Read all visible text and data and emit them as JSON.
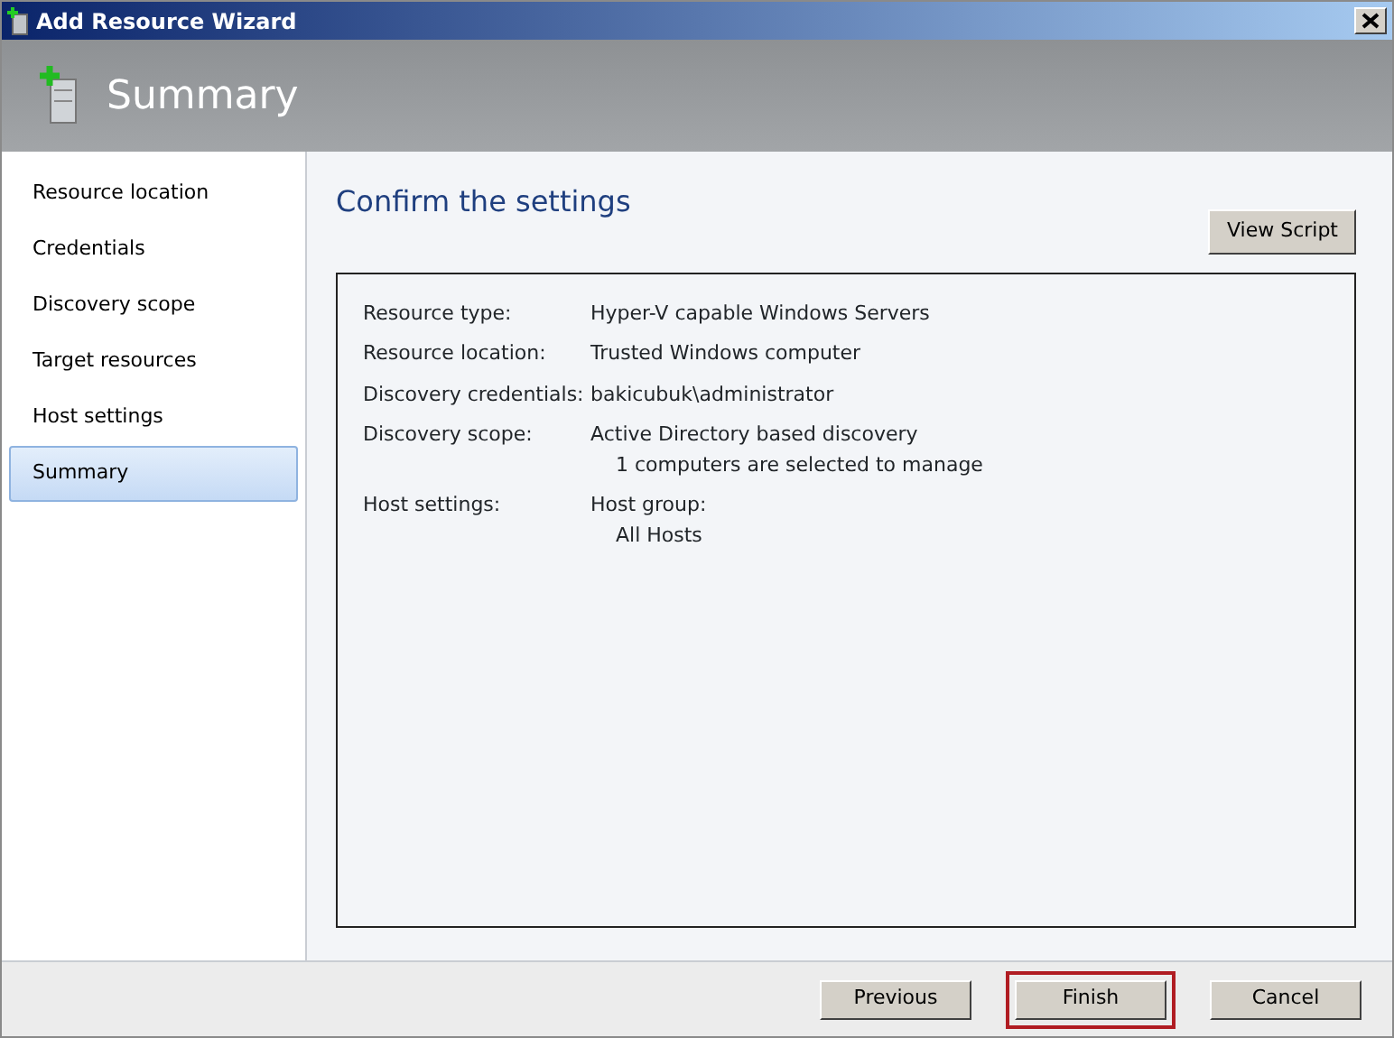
{
  "window": {
    "title": "Add Resource Wizard"
  },
  "header": {
    "title": "Summary"
  },
  "sidebar": {
    "items": [
      {
        "label": "Resource location",
        "selected": false
      },
      {
        "label": "Credentials",
        "selected": false
      },
      {
        "label": "Discovery scope",
        "selected": false
      },
      {
        "label": "Target resources",
        "selected": false
      },
      {
        "label": "Host settings",
        "selected": false
      },
      {
        "label": "Summary",
        "selected": true
      }
    ]
  },
  "content": {
    "heading": "Confirm the settings",
    "view_script_button": "View Script",
    "settings": [
      {
        "label": "Resource type:",
        "value": "Hyper-V capable Windows Servers"
      },
      {
        "label": "Resource location:",
        "value": "Trusted Windows computer"
      },
      {
        "label": "Discovery credentials:",
        "value": "bakicubuk\\administrator"
      },
      {
        "label": "Discovery scope:",
        "value": "Active Directory based discovery",
        "detail": "1 computers are selected to manage"
      },
      {
        "label": "Host settings:",
        "value": "Host group:",
        "detail": "All Hosts"
      }
    ]
  },
  "buttons": [
    {
      "label": "Previous",
      "highlighted": false
    },
    {
      "label": "Finish",
      "highlighted": true
    },
    {
      "label": "Cancel",
      "highlighted": false
    }
  ]
}
